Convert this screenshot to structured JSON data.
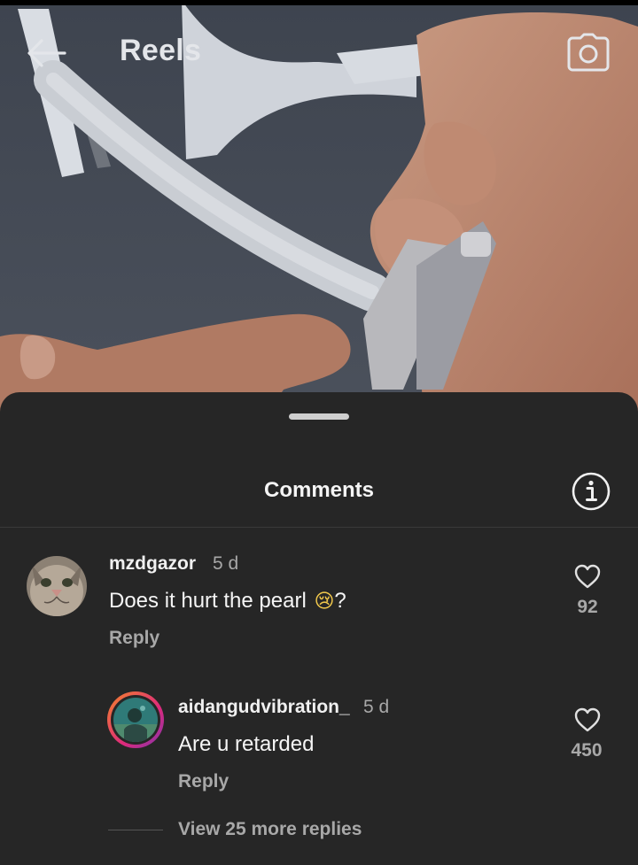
{
  "header": {
    "title": "Reels",
    "back_icon": "arrow-left-icon",
    "camera_icon": "camera-icon"
  },
  "sheet": {
    "title": "Comments",
    "info_icon": "info-icon"
  },
  "comments": [
    {
      "username": "mzdgazor",
      "time": "5 d",
      "text_before": "Does it hurt the pearl ",
      "emoji": "😢",
      "text_after": "?",
      "reply_label": "Reply",
      "likes": "92"
    }
  ],
  "replies": [
    {
      "username": "aidangudvibration_",
      "time": "5 d",
      "text": "Are u retarded",
      "reply_label": "Reply",
      "likes": "450"
    }
  ],
  "view_more": "View 25 more replies",
  "colors": {
    "sheet_bg": "#262626",
    "text_primary": "#f5f5f5",
    "text_secondary": "#a8a8a8",
    "story_ring_start": "#f58529",
    "story_ring_end": "#dd2a7b"
  }
}
